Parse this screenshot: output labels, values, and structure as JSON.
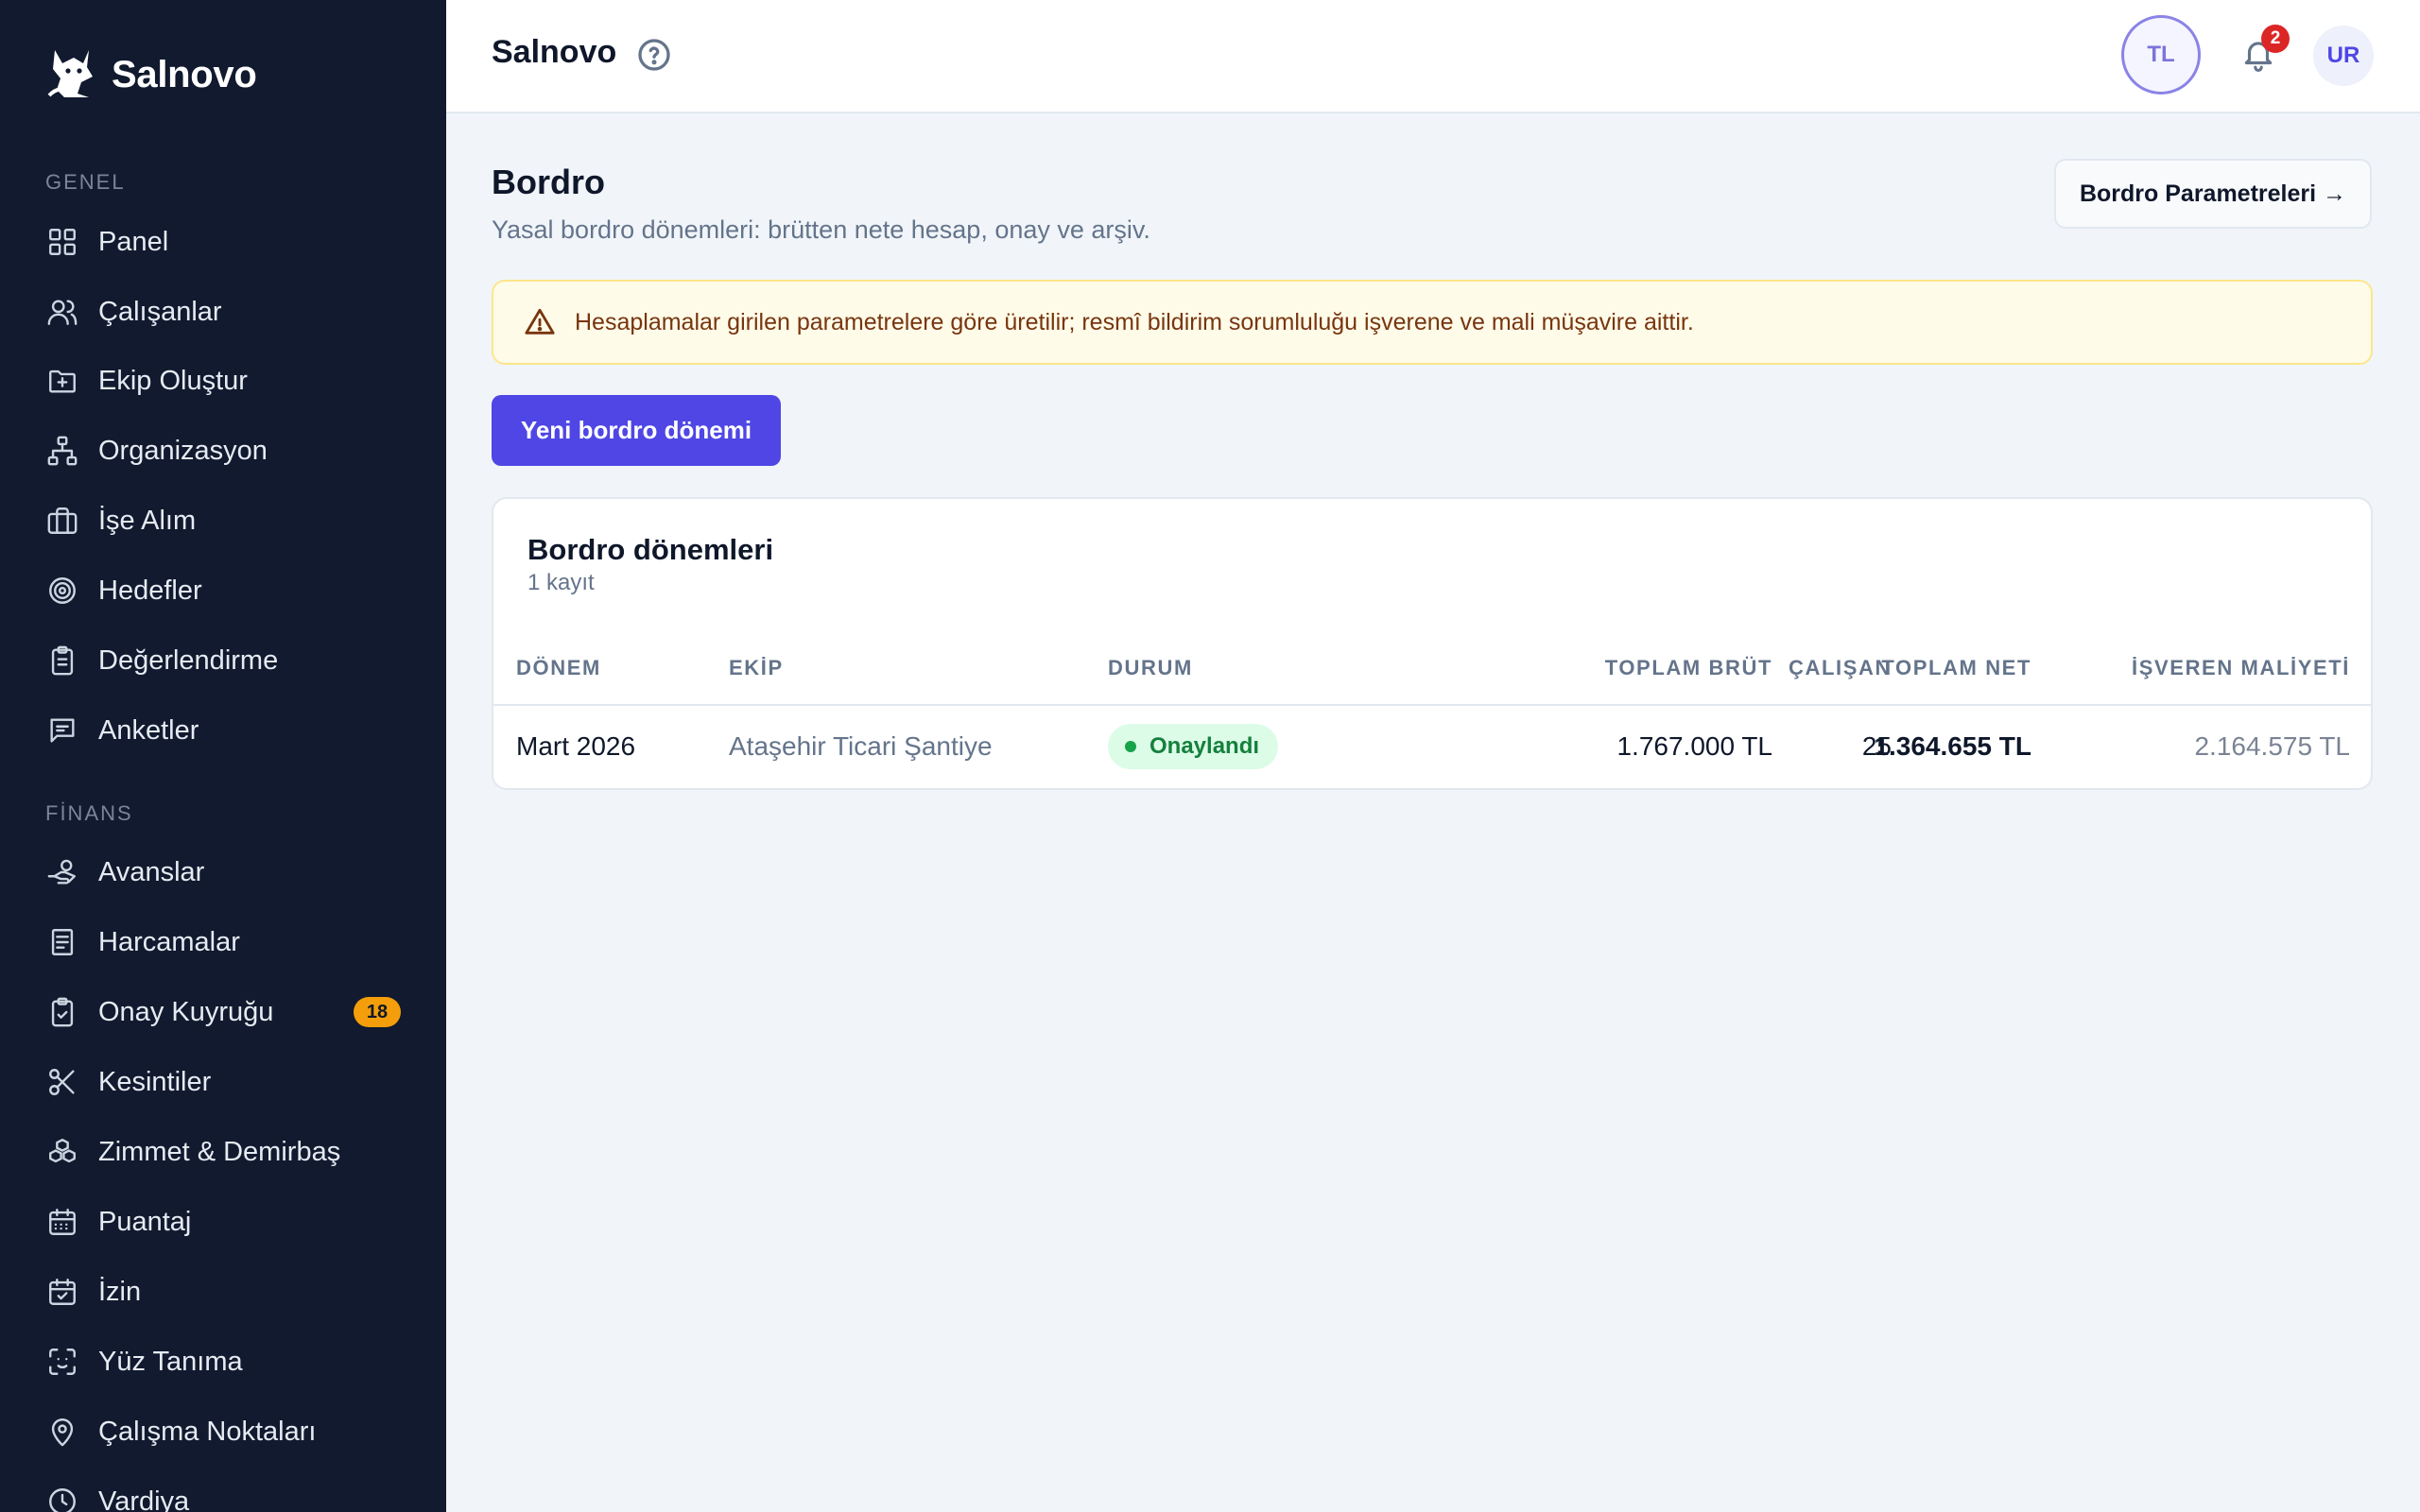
{
  "brand": {
    "name": "Salnovo"
  },
  "sidebar": {
    "sections": [
      {
        "label": "GENEL"
      },
      {
        "label": "FİNANS"
      }
    ],
    "items": [
      {
        "label": "Panel",
        "icon": "grid-icon"
      },
      {
        "label": "Çalışanlar",
        "icon": "users-icon"
      },
      {
        "label": "Ekip Oluştur",
        "icon": "folder-plus-icon"
      },
      {
        "label": "Organizasyon",
        "icon": "org-chart-icon"
      },
      {
        "label": "İşe Alım",
        "icon": "briefcase-icon"
      },
      {
        "label": "Hedefler",
        "icon": "target-icon"
      },
      {
        "label": "Değerlendirme",
        "icon": "clipboard-icon"
      },
      {
        "label": "Anketler",
        "icon": "message-icon"
      },
      {
        "label": "Avanslar",
        "icon": "hand-coins-icon"
      },
      {
        "label": "Harcamalar",
        "icon": "receipt-icon"
      },
      {
        "label": "Onay Kuyruğu",
        "icon": "clipboard-check-icon",
        "badge": "18"
      },
      {
        "label": "Kesintiler",
        "icon": "scissors-icon"
      },
      {
        "label": "Zimmet & Demirbaş",
        "icon": "boxes-icon"
      },
      {
        "label": "Puantaj",
        "icon": "calendar-grid-icon"
      },
      {
        "label": "İzin",
        "icon": "calendar-check-icon"
      },
      {
        "label": "Yüz Tanıma",
        "icon": "face-scan-icon"
      },
      {
        "label": "Çalışma Noktaları",
        "icon": "map-pin-icon"
      },
      {
        "label": "Vardiya",
        "icon": "clock-icon"
      }
    ]
  },
  "topbar": {
    "title": "Salnovo",
    "currency": "TL",
    "notifications": "2",
    "avatar_initials": "UR"
  },
  "page": {
    "title": "Bordro",
    "subtitle": "Yasal bordro dönemleri: brütten nete hesap, onay ve arşiv.",
    "params_button": "Bordro Parametreleri →",
    "alert": "Hesaplamalar girilen parametrelere göre üretilir; resmî bildirim sorumluluğu işverene ve mali müşavire aittir.",
    "new_button": "Yeni bordro dönemi"
  },
  "table": {
    "title": "Bordro dönemleri",
    "count": "1 kayıt",
    "columns": [
      "DÖNEM",
      "EKİP",
      "DURUM",
      "ÇALIŞAN",
      "TOPLAM BRÜT",
      "TOPLAM NET",
      "İŞVEREN MALİYETİ"
    ],
    "rows": [
      {
        "period": "Mart 2026",
        "team": "Ataşehir Ticari Şantiye",
        "status": "Onaylandı",
        "employees": "25",
        "gross": "1.767.000 TL",
        "net": "1.364.655 TL",
        "employer_cost": "2.164.575 TL"
      }
    ]
  },
  "colors": {
    "sidebar_bg": "#111a2e",
    "accent": "#4f46e5",
    "badge": "#f59e0b",
    "success": "#15803d",
    "warning_text": "#78350f"
  }
}
